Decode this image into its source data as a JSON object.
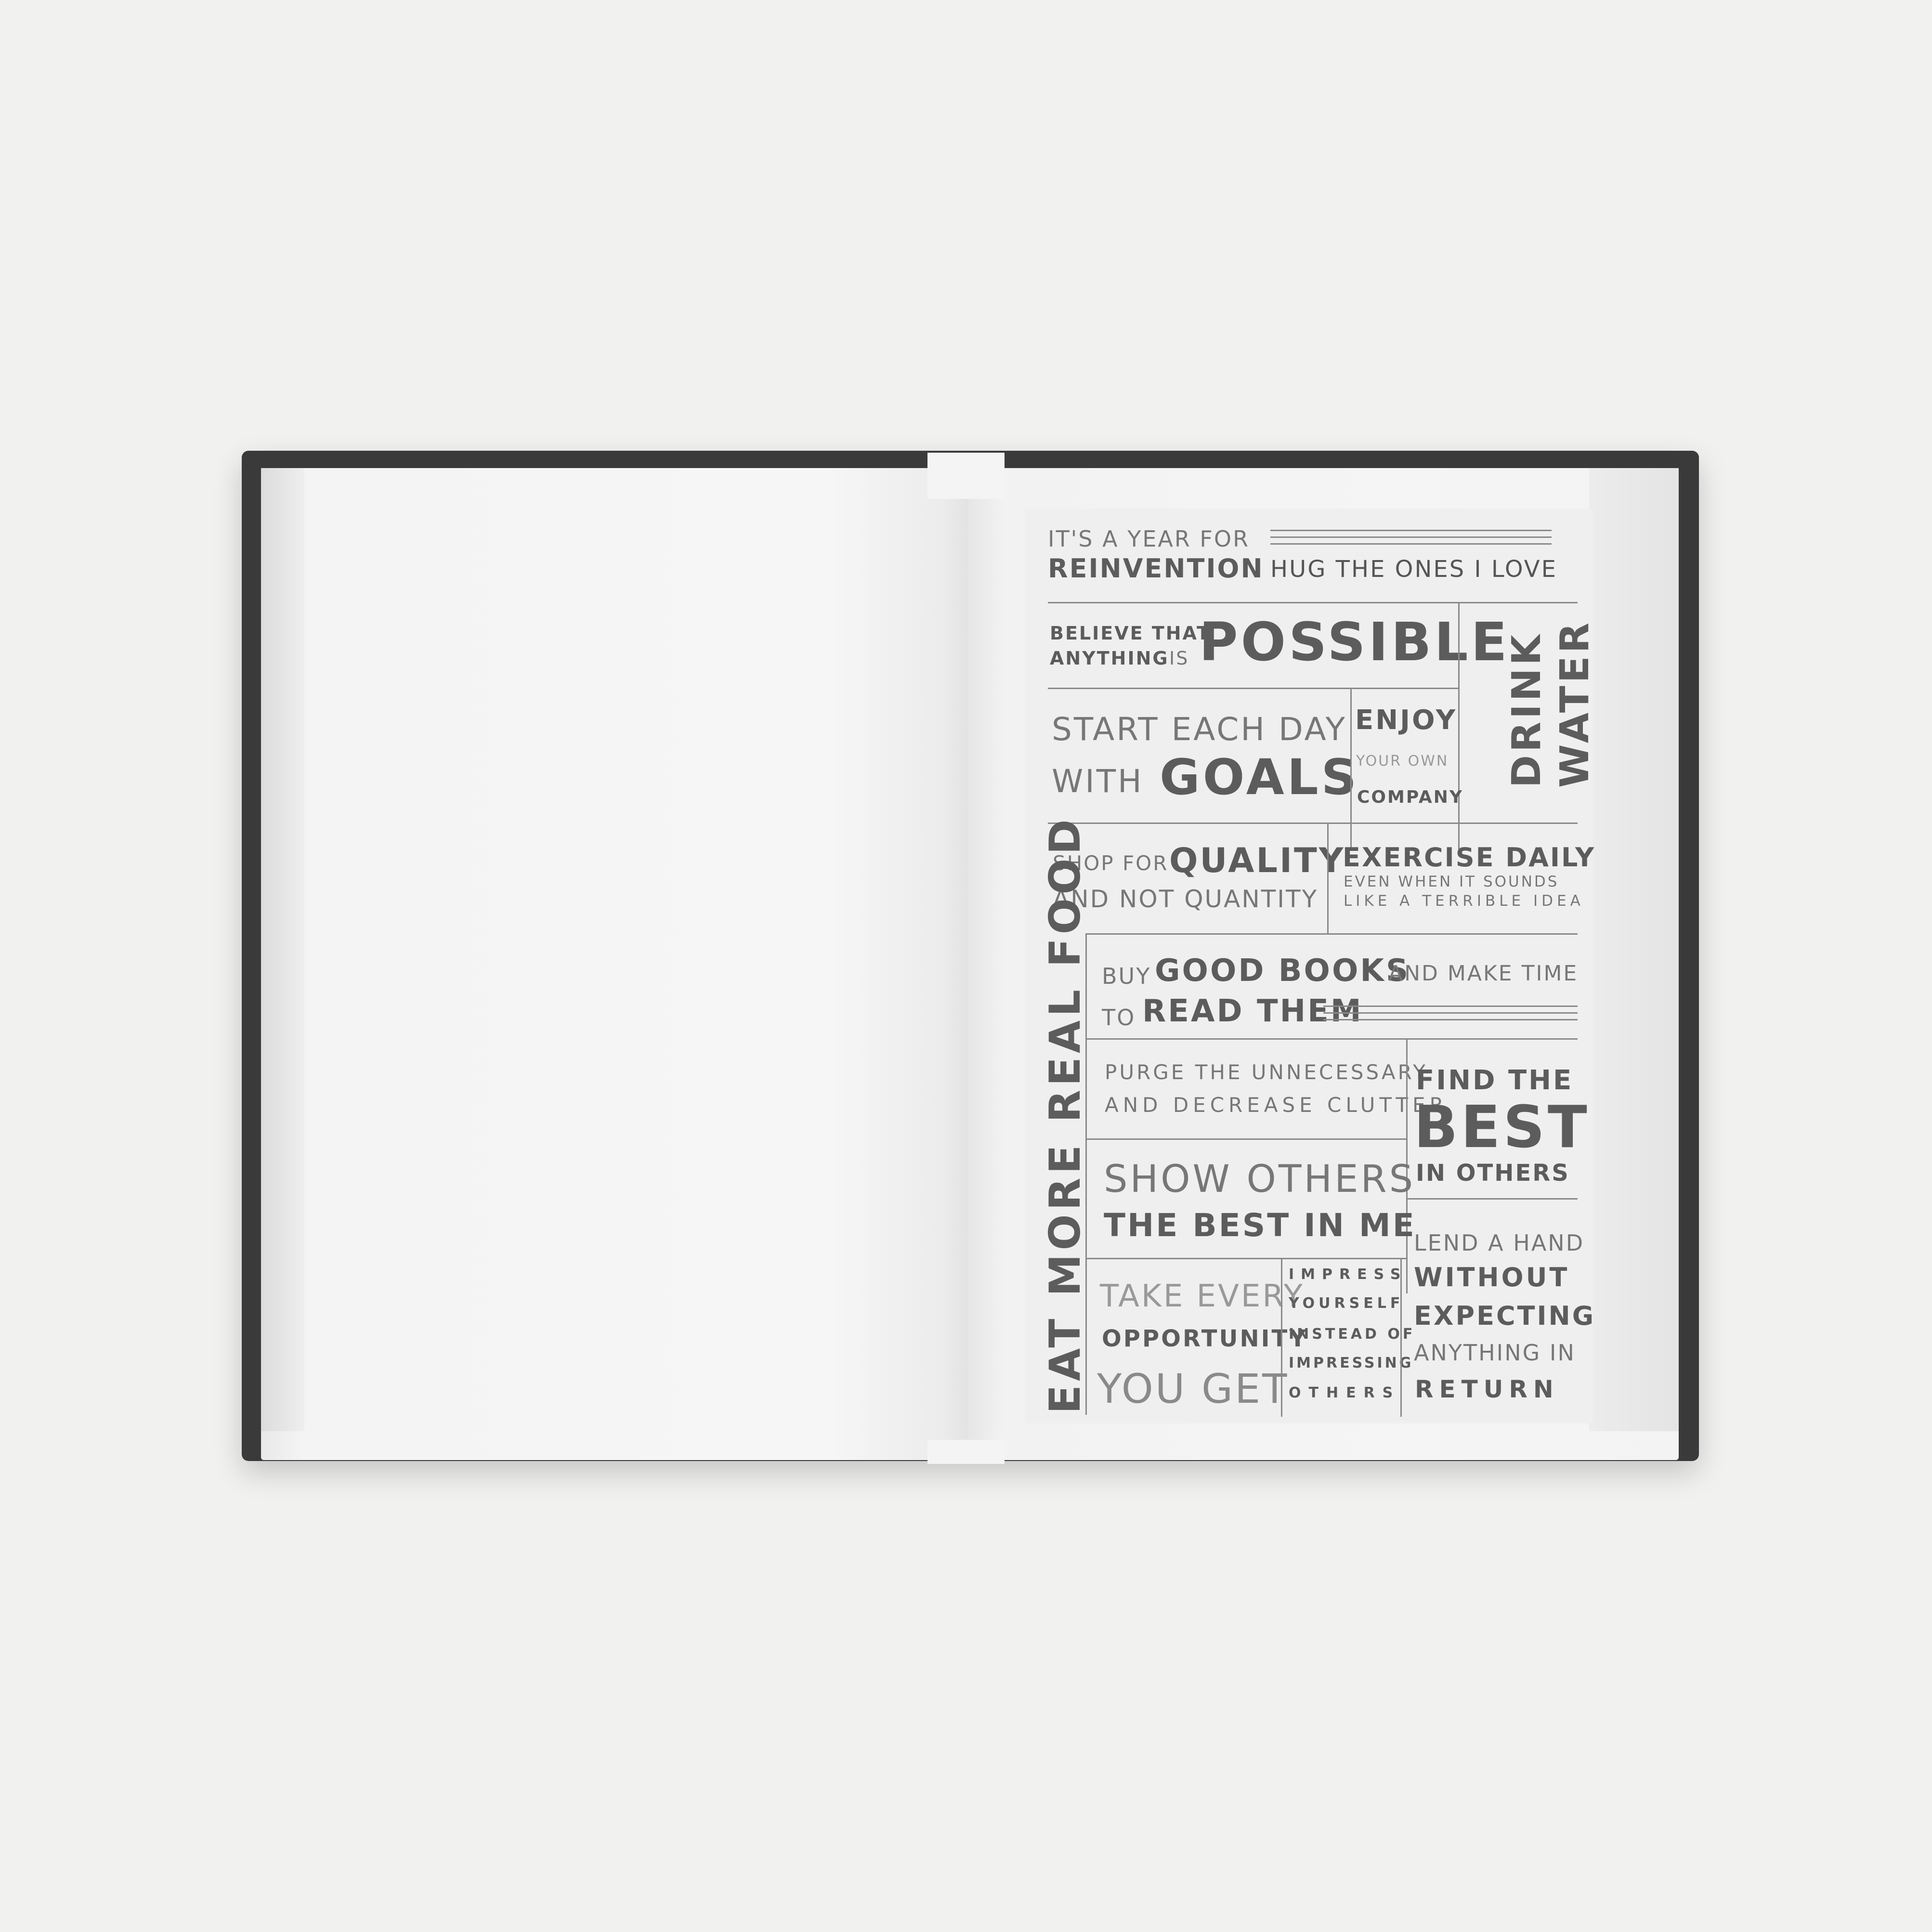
{
  "poster": {
    "reinvention": {
      "line1": "IT'S A YEAR FOR",
      "line2": "REINVENTION"
    },
    "hug": "HUG THE ONES I LOVE",
    "believe": {
      "small1": "BELIEVE THAT",
      "small2": "ANYTHING",
      "is": "IS",
      "big": "POSSIBLE"
    },
    "drink_water": {
      "line1": "DRINK",
      "line2": "WATER"
    },
    "goals": {
      "line1": "START EACH DAY",
      "with": "WITH",
      "big": "GOALS"
    },
    "enjoy": {
      "line1": "ENJOY",
      "line2": "YOUR OWN",
      "line3": "COMPANY"
    },
    "quality": {
      "shop": "SHOP FOR",
      "big": "QUALITY",
      "line2": "AND NOT QUANTITY"
    },
    "exercise": {
      "line1": "EXERCISE DAILY",
      "line2": "EVEN WHEN IT SOUNDS",
      "line3": "LIKE A TERRIBLE IDEA"
    },
    "eat": "EAT MORE REAL FOOD",
    "books": {
      "buy": "BUY",
      "big1": "GOOD BOOKS",
      "make": "AND MAKE TIME",
      "to": "TO",
      "big2": "READ THEM"
    },
    "purge": {
      "line1": "PURGE THE UNNECESSARY",
      "line2": "AND DECREASE CLUTTER"
    },
    "find_best": {
      "line1": "FIND THE",
      "line2": "BEST",
      "line3": "IN OTHERS"
    },
    "show_others": {
      "line1": "SHOW OTHERS",
      "line2": "THE BEST IN ME"
    },
    "lend": {
      "line1": "LEND A HAND",
      "line2": "WITHOUT",
      "line3": "EXPECTING",
      "line4": "ANYTHING IN",
      "line5": "RETURN"
    },
    "take": {
      "line1": "TAKE EVERY",
      "line2": "OPPORTUNITY",
      "line3": "YOU GET"
    },
    "impress": {
      "line1": "IMPRESS",
      "line2": "YOURSELF",
      "line3": "INSTEAD OF",
      "line4": "IMPRESSING",
      "line5": "OTHERS"
    }
  }
}
